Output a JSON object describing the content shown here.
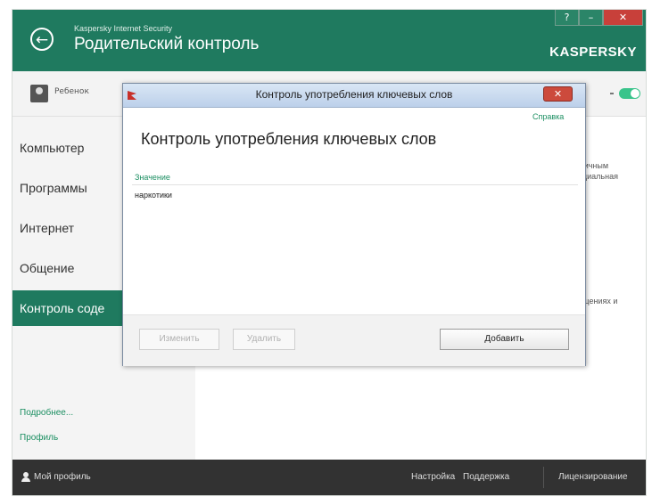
{
  "app": {
    "product_name": "Kaspersky Internet Security",
    "title": "Родительский контроль",
    "logo": "KASPERSKY",
    "window_buttons": {
      "help": "?",
      "minimize": "–",
      "close": "✕"
    },
    "colors": {
      "header": "#1f7a5f",
      "active_nav": "#1f7a5f",
      "link": "#1c8f62",
      "footer": "#323232"
    }
  },
  "topbar": {
    "child_name": "Ребенок"
  },
  "sidebar": {
    "items": [
      {
        "label": "Компьютер"
      },
      {
        "label": "Программы"
      },
      {
        "label": "Интернет"
      },
      {
        "label": "Общение"
      },
      {
        "label": "Контроль соде"
      }
    ],
    "links": [
      "Подробнее...",
      "Профиль"
    ]
  },
  "main_background": {
    "text1": "к личным",
    "text2": "енциальная",
    "text3": "общениях и"
  },
  "footer": {
    "my_profile": "Мой профиль",
    "settings": "Настройка",
    "support": "Поддержка",
    "licensing": "Лицензирование"
  },
  "dialog": {
    "title": "Контроль употребления ключевых слов",
    "close": "✕",
    "help_link": "Справка",
    "heading": "Контроль употребления ключевых слов",
    "column_header": "Значение",
    "words": [
      "наркотики"
    ],
    "buttons": {
      "edit": "Изменить",
      "delete": "Удалить",
      "add": "Добавить"
    }
  }
}
